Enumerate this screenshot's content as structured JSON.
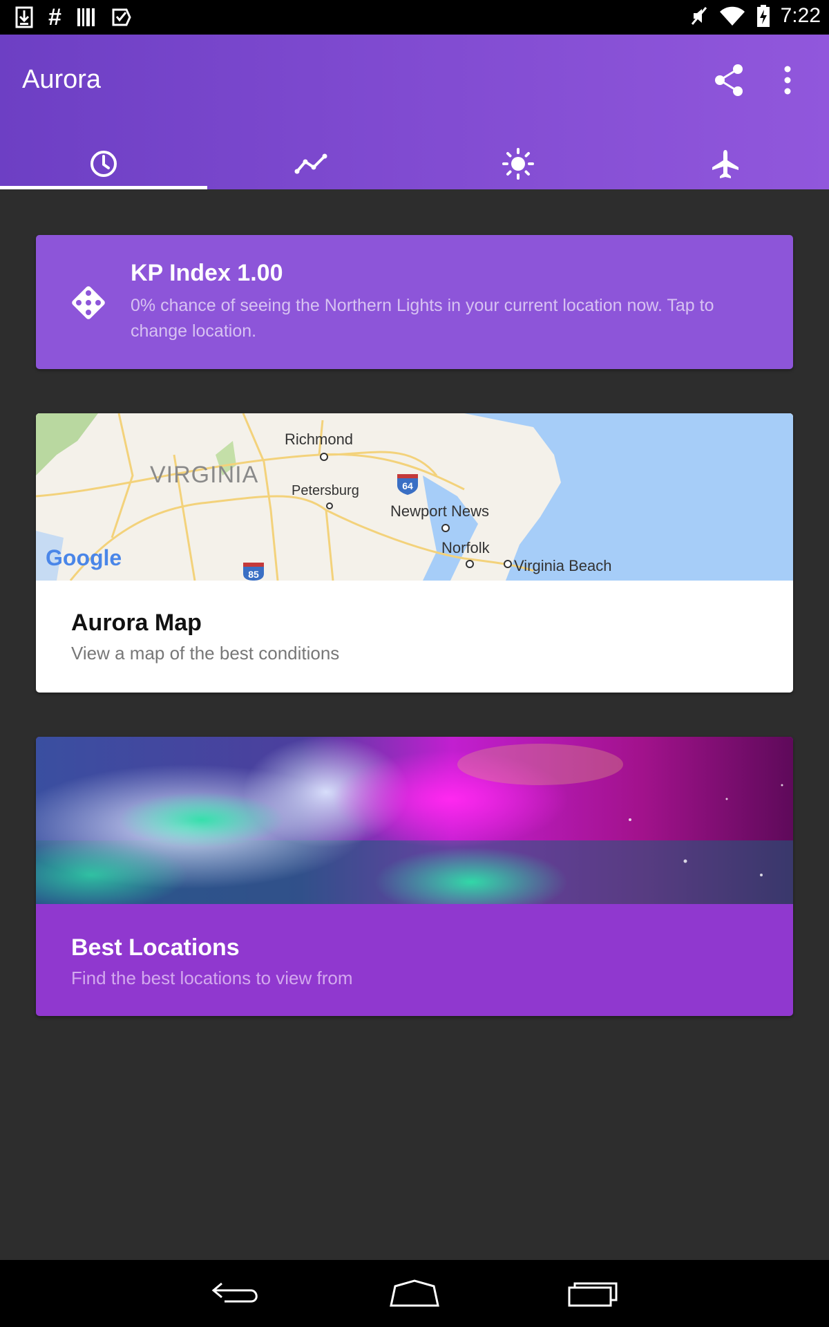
{
  "status_bar": {
    "time": "7:22",
    "hash_glyph": "#",
    "left_icons": [
      "download-icon",
      "hash-icon",
      "barcode-icon",
      "task-check-icon"
    ],
    "right_icons": [
      "mute-icon",
      "wifi-icon",
      "battery-charging-icon"
    ]
  },
  "app_bar": {
    "title": "Aurora",
    "actions": [
      "share-icon",
      "overflow-menu-icon"
    ]
  },
  "tabs": [
    {
      "icon": "clock-icon",
      "selected": true
    },
    {
      "icon": "trend-chart-icon",
      "selected": false
    },
    {
      "icon": "sun-icon",
      "selected": false
    },
    {
      "icon": "airplane-icon",
      "selected": false
    }
  ],
  "kp_card": {
    "title": "KP Index 1.00",
    "description": "0% chance of seeing the Northern Lights in your current location now. Tap to change location."
  },
  "map_card": {
    "title": "Aurora Map",
    "subtitle": "View a map of the best conditions",
    "map_labels": {
      "virginia": "VIRGINIA",
      "richmond": "Richmond",
      "petersburg": "Petersburg",
      "newport_news": "Newport News",
      "norfolk": "Norfolk",
      "virginia_beach": "Virginia Beach",
      "interstate_64": "64",
      "interstate_85": "85",
      "google_logo": "Google"
    }
  },
  "locations_card": {
    "title": "Best Locations",
    "subtitle": "Find the best locations to view from"
  },
  "nav_bar": {
    "buttons": [
      "back-icon",
      "home-icon",
      "recents-icon"
    ]
  },
  "colors": {
    "app_bar_start": "#6d3fc4",
    "app_bar_end": "#9157dc",
    "kp_card": "#8d55d9",
    "locations_card": "#9038cf",
    "background": "#2d2d2d"
  }
}
